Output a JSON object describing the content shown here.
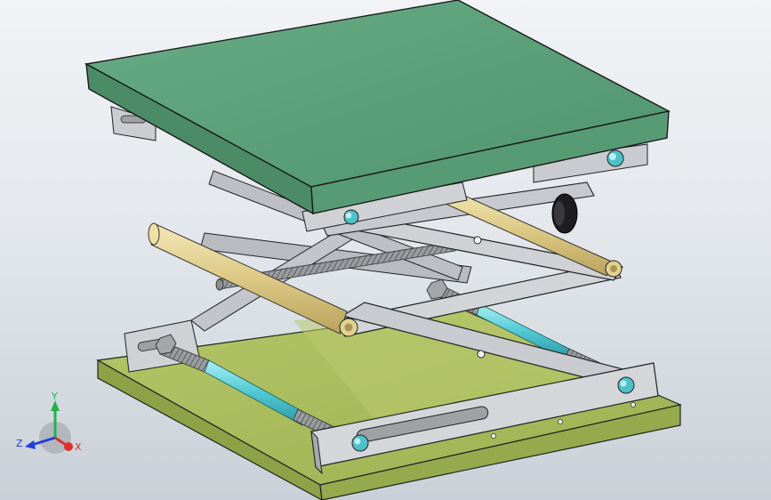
{
  "viewport": {
    "background_top": "#f1f3f5",
    "background_bottom": "#c9d0d7"
  },
  "model": {
    "top_plate_color": "#5aa079",
    "base_plate_color": "#a7ba5a",
    "scissor_arm_color": "#c9cbd0",
    "rod_color": "#e1d08f",
    "screw_rod_color": "#62d4dc",
    "pin_color": "#63c9d0"
  },
  "triad": {
    "y_label": "Y",
    "z_label": "Z",
    "x_label": "X",
    "y_color": "#22b24c",
    "x_color": "#e0302a",
    "z_color": "#2040d8"
  }
}
